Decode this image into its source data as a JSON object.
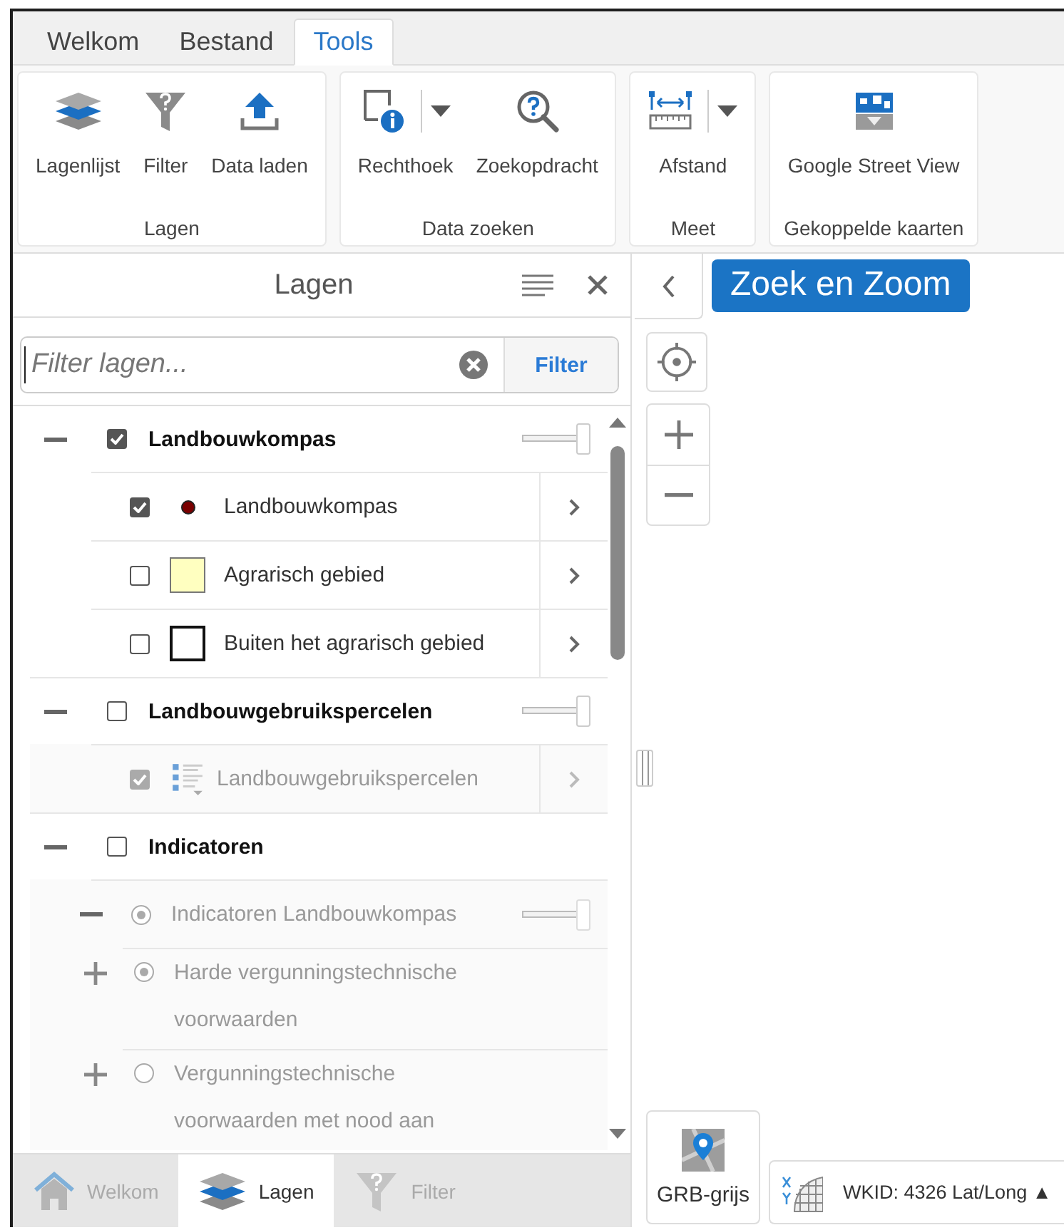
{
  "tabs": [
    {
      "label": "Welkom",
      "selected": false
    },
    {
      "label": "Bestand",
      "selected": false
    },
    {
      "label": "Tools",
      "selected": true
    }
  ],
  "ribbon": {
    "groups": [
      {
        "title": "Lagen",
        "tools": [
          {
            "label": "Lagenlijst",
            "kind": "layers",
            "dropdown": false
          },
          {
            "label": "Filter",
            "kind": "funnel",
            "dropdown": false
          },
          {
            "label": "Data laden",
            "kind": "upload",
            "dropdown": false
          }
        ]
      },
      {
        "title": "Data zoeken",
        "tools": [
          {
            "label": "Rechthoek",
            "kind": "rect-info",
            "dropdown": true
          },
          {
            "label": "Zoekopdracht",
            "kind": "search",
            "dropdown": false
          }
        ]
      },
      {
        "title": "Meet",
        "tools": [
          {
            "label": "Afstand",
            "kind": "measure",
            "dropdown": true
          }
        ]
      },
      {
        "title": "Gekoppelde kaarten",
        "tools": [
          {
            "label": "Google Street View",
            "kind": "streetview",
            "dropdown": false
          }
        ]
      }
    ]
  },
  "layers_panel": {
    "title": "Lagen",
    "filter": {
      "placeholder": "Filter lagen...",
      "button": "Filter"
    },
    "tree": [
      {
        "kind": "group",
        "label": "Landbouwkompas",
        "checked": true,
        "expanded": true,
        "disabled": false,
        "level": 1,
        "children": [
          {
            "kind": "layer",
            "label": "Landbouwkompas",
            "checked": true,
            "disabled": false,
            "legend": {
              "kind": "dot",
              "color": "#7a0000"
            }
          },
          {
            "kind": "layer",
            "label": "Agrarisch gebied",
            "checked": false,
            "disabled": false,
            "legend": {
              "kind": "fill",
              "color": "#ffffc0"
            }
          },
          {
            "kind": "layer",
            "label": "Buiten het agrarisch gebied",
            "checked": false,
            "disabled": false,
            "legend": {
              "kind": "outline",
              "color": "#ffffff"
            }
          }
        ]
      },
      {
        "kind": "group",
        "label": "Landbouwgebruikspercelen",
        "checked": false,
        "expanded": true,
        "disabled": false,
        "level": 1,
        "children": [
          {
            "kind": "layer",
            "label": "Landbouwgebruikspercelen",
            "checked": true,
            "disabled": true,
            "legend": {
              "kind": "list"
            }
          }
        ]
      },
      {
        "kind": "group",
        "label": "Indicatoren",
        "checked": false,
        "expanded": true,
        "disabled": false,
        "children": [
          {
            "kind": "radio-group",
            "label": "Indicatoren Landbouwkompas",
            "selected": true,
            "expanded": true,
            "disabled": true,
            "level": 1,
            "children": [
              {
                "kind": "radio-layer",
                "label": "Harde vergunningstechnische voorwaarden",
                "selected": true,
                "expanded": false,
                "disabled": true
              },
              {
                "kind": "radio-layer",
                "label": "Vergunningstechnische voorwaarden met nood aan",
                "selected": false,
                "expanded": false,
                "disabled": true
              }
            ]
          }
        ]
      }
    ]
  },
  "map": {
    "search_button": "Zoek en Zoom",
    "basemap": {
      "label": "GRB-grijs"
    },
    "coordinates": {
      "label": "WKID: 4326 Lat/Long ▲"
    }
  },
  "bottom_tabs": [
    {
      "label": "Welkom",
      "kind": "home",
      "selected": false
    },
    {
      "label": "Lagen",
      "kind": "layers",
      "selected": true
    },
    {
      "label": "Filter",
      "kind": "funnel",
      "selected": false
    }
  ]
}
